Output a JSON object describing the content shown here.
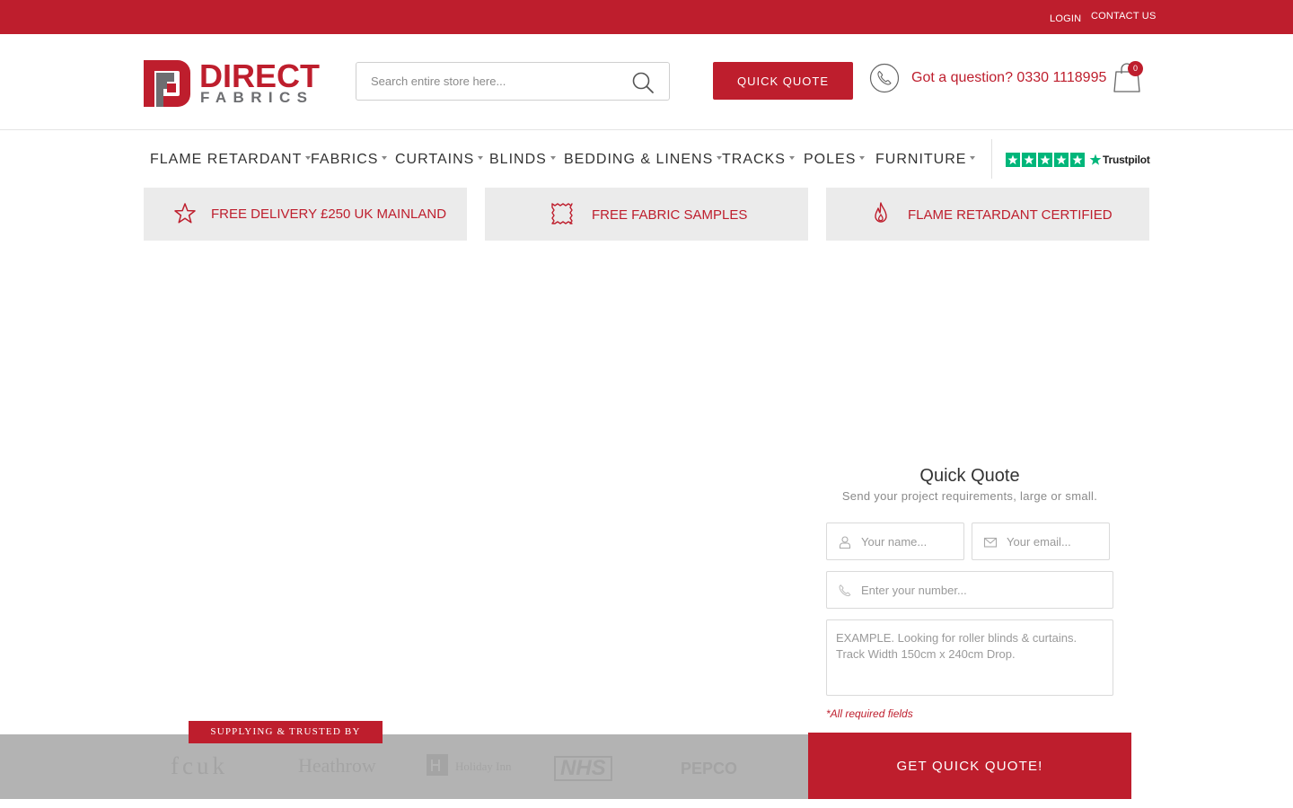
{
  "topbar": {
    "login": "LOGIN",
    "contact": "CONTACT US"
  },
  "header": {
    "logo": {
      "word1": "DIRECT",
      "word2": "FABRICS"
    },
    "search": {
      "placeholder": "Search entire store here..."
    },
    "quick_quote_label": "QUICK QUOTE",
    "phone_text": "Got a question? 0330 1118995",
    "cart_count": "0"
  },
  "nav": {
    "items": [
      {
        "label": "FLAME RETARDANT"
      },
      {
        "label": "FABRICS"
      },
      {
        "label": "CURTAINS"
      },
      {
        "label": "BLINDS"
      },
      {
        "label": "BEDDING & LINENS"
      },
      {
        "label": "TRACKS"
      },
      {
        "label": "POLES"
      },
      {
        "label": "FURNITURE"
      }
    ],
    "trustpilot_label": "Trustpilot"
  },
  "usps": [
    {
      "label": "FREE DELIVERY £250 UK MAINLAND",
      "icon": "star-icon"
    },
    {
      "label": "FREE FABRIC SAMPLES",
      "icon": "fabric-swatch-icon"
    },
    {
      "label": "FLAME RETARDANT CERTIFIED",
      "icon": "flame-icon"
    }
  ],
  "quote_form": {
    "title": "Quick Quote",
    "subtitle": "Send your project requirements, large or small.",
    "name_placeholder": "Your name...",
    "email_placeholder": "Your email...",
    "number_placeholder": "Enter your number...",
    "message_placeholder": "EXAMPLE. Looking for roller blinds & curtains.\nTrack Width 150cm x 240cm Drop.",
    "required_note": "*All required fields",
    "submit_label": "GET QUICK QUOTE!"
  },
  "trusted": {
    "tag": "SUPPLYING & TRUSTED BY",
    "brands": [
      "fcuk",
      "Heathrow",
      "Holiday Inn",
      "NHS",
      "PEPCO"
    ]
  },
  "colors": {
    "brand_red": "#be1e2d",
    "usp_bg": "#ebebeb",
    "strip_gray": "#b3b3b3",
    "trustpilot_green": "#00b67a"
  }
}
